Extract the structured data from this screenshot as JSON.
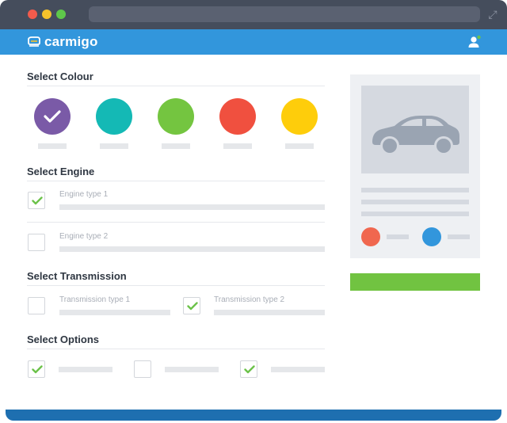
{
  "window": {
    "expand_glyph": "⤢"
  },
  "app": {
    "logo_text": "carmigo",
    "brand_color": "#3296dc"
  },
  "sections": {
    "colour": {
      "title": "Select Colour",
      "swatches": [
        {
          "color": "#7a5aa7",
          "selected": true
        },
        {
          "color": "#14b9b5",
          "selected": false
        },
        {
          "color": "#74c540",
          "selected": false
        },
        {
          "color": "#f0503f",
          "selected": false
        },
        {
          "color": "#fecd0b",
          "selected": false
        }
      ]
    },
    "engine": {
      "title": "Select Engine",
      "options": [
        {
          "label": "Engine type 1",
          "checked": true
        },
        {
          "label": "Engine type 2",
          "checked": false
        }
      ]
    },
    "transmission": {
      "title": "Select Transmission",
      "options": [
        {
          "label": "Transmission type 1",
          "checked": false
        },
        {
          "label": "Transmission type 2",
          "checked": true
        }
      ]
    },
    "options": {
      "title": "Select Options",
      "items": [
        {
          "checked": true
        },
        {
          "checked": false
        },
        {
          "checked": true
        }
      ]
    }
  },
  "preview": {
    "icon": "car-icon",
    "colors": [
      "#f0674f",
      "#3296dc"
    ]
  },
  "colors": {
    "check": "#6cc24a",
    "cta": "#71c341"
  }
}
